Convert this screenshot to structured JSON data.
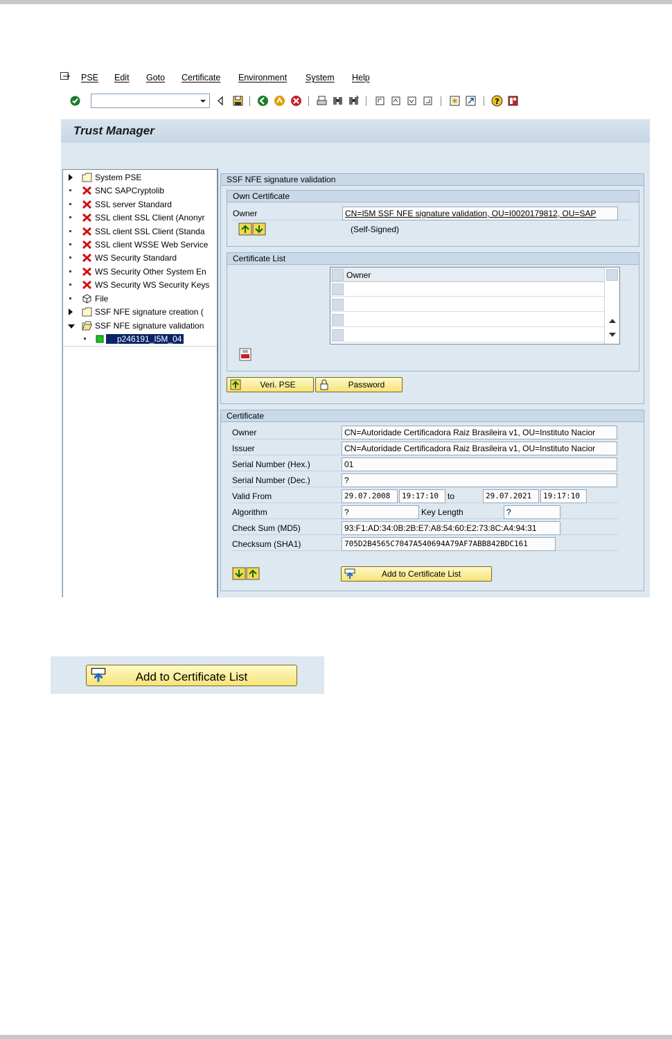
{
  "menu": {
    "items": [
      {
        "label": "PSE"
      },
      {
        "label": "Edit"
      },
      {
        "label": "Goto"
      },
      {
        "label": "Certificate"
      },
      {
        "label": "Environment"
      },
      {
        "label": "System"
      },
      {
        "label": "Help"
      }
    ]
  },
  "toolbar": {
    "command_field_value": ""
  },
  "screen": {
    "title": "Trust Manager"
  },
  "tree": {
    "items": [
      {
        "label": "System PSE",
        "icon": "folder-icon"
      },
      {
        "label": "SNC SAPCryptolib",
        "icon": "error-x-icon"
      },
      {
        "label": "SSL server Standard",
        "icon": "error-x-icon"
      },
      {
        "label": "SSL client SSL Client (Anonyr",
        "icon": "error-x-icon"
      },
      {
        "label": "SSL client SSL Client (Standa",
        "icon": "error-x-icon"
      },
      {
        "label": "SSL client WSSE Web Service",
        "icon": "error-x-icon"
      },
      {
        "label": "WS Security Standard",
        "icon": "error-x-icon"
      },
      {
        "label": "WS Security Other System En",
        "icon": "error-x-icon"
      },
      {
        "label": "WS Security WS Security Keys",
        "icon": "error-x-icon"
      },
      {
        "label": "File",
        "icon": "cube-icon"
      },
      {
        "label": "SSF NFE signature creation (",
        "icon": "folder-icon"
      },
      {
        "label": "SSF NFE signature validation",
        "icon": "open-folder-icon"
      },
      {
        "label": "p246191_I5M_04",
        "icon": "green-square-icon"
      }
    ]
  },
  "pse_panel": {
    "title": "SSF NFE signature validation",
    "own_certificate": {
      "title": "Own Certificate",
      "owner_label": "Owner",
      "owner_value": "CN=I5M SSF NFE signature validation, OU=I0020179812, OU=SAP",
      "note": "(Self-Signed)"
    },
    "certificate_list": {
      "title": "Certificate List",
      "column_owner": "Owner",
      "rows": [
        "",
        "",
        "",
        ""
      ]
    },
    "buttons": {
      "veri_pse": "Veri. PSE",
      "password": "Password"
    }
  },
  "certificate": {
    "title": "Certificate",
    "fields": {
      "owner_label": "Owner",
      "owner_value": "CN=Autoridade Certificadora Raiz Brasileira v1, OU=Instituto Nacior",
      "issuer_label": "Issuer",
      "issuer_value": "CN=Autoridade Certificadora Raiz Brasileira v1, OU=Instituto Nacior",
      "serial_hex_label": "Serial Number (Hex.)",
      "serial_hex_value": "01",
      "serial_dec_label": "Serial Number (Dec.)",
      "serial_dec_value": "?",
      "valid_from_label": "Valid From",
      "valid_from_date": "29.07.2008",
      "valid_from_time": "19:17:10",
      "to_label": "to",
      "valid_to_date": "29.07.2021",
      "valid_to_time": "19:17:10",
      "algorithm_label": "Algorithm",
      "algorithm_value": "?",
      "key_length_label": "Key Length",
      "key_length_value": "?",
      "md5_label": "Check Sum (MD5)",
      "md5_value": "93:F1:AD:34:0B:2B:E7:A8:54:60:E2:73:8C:A4:94:31",
      "sha1_label": "Checksum (SHA1)",
      "sha1_value": "705D2B4565C7047A540694A79AF7ABB842BDC161"
    },
    "add_button": "Add to Certificate List"
  },
  "excerpt": {
    "add_button": "Add to Certificate List"
  }
}
